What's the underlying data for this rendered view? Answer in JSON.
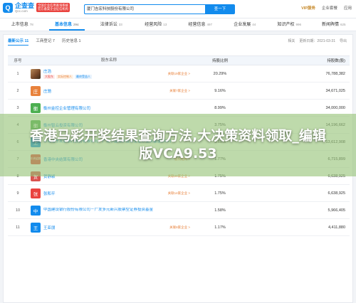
{
  "header": {
    "logo_mark": "Q",
    "logo_name": "企查查",
    "logo_domain": "Qcc.com",
    "slogan_lines": [
      "全国企业信用查询系统",
      "官方备案企业征信机构"
    ],
    "search_value": "厦门吉宏科技股份有限公司",
    "search_button": "查一下",
    "vip": "VIP服务",
    "links": [
      "企业套餐",
      "应用"
    ]
  },
  "tabs": [
    {
      "label": "上市信息",
      "count": "78"
    },
    {
      "label": "基本信息",
      "count": "294"
    },
    {
      "label": "法律诉讼",
      "count": "33"
    },
    {
      "label": "经营风险",
      "count": "13"
    },
    {
      "label": "经营信息",
      "count": "497"
    },
    {
      "label": "企业发展",
      "count": "44"
    },
    {
      "label": "知识产权",
      "count": "996"
    },
    {
      "label": "新闻舆情",
      "count": "625"
    }
  ],
  "subtabs": [
    "最新公示 11",
    "工商登记 7",
    "历史信息 1"
  ],
  "meta": [
    "相关",
    "更新日期：2021-03-31",
    "导出"
  ],
  "columns": {
    "index": "序号",
    "holder": "股东名称",
    "ratio": "持股比例",
    "amount": "持股数(股)"
  },
  "rows": [
    {
      "idx": "1",
      "avatar": "",
      "avatar_color": "#8b5a3c",
      "name": "庄浩",
      "relation": "关联19家企业 >",
      "tags": [
        "大股东",
        "实际控制人",
        "最终受益人"
      ],
      "ratio": "20.29%",
      "amount": "76,788,382"
    },
    {
      "idx": "2",
      "avatar": "庄",
      "avatar_color": "#e8823c",
      "name": "庄驰",
      "relation": "关联7家企业 >",
      "tags": [],
      "ratio": "9.16%",
      "amount": "34,671,025"
    },
    {
      "idx": "3",
      "avatar": "衡",
      "avatar_color": "#4caf50",
      "name": "衡州金控企业管理有限公司",
      "relation": "",
      "tags": [],
      "ratio": "8.99%",
      "amount": "34,000,000"
    },
    {
      "idx": "4",
      "avatar": "衡",
      "avatar_color": "#4caf50",
      "name": "衡州智云投资有限公司",
      "relation": "",
      "tags": [],
      "ratio": "3.75%",
      "amount": "14,196,662"
    },
    {
      "idx": "6",
      "avatar": "上",
      "avatar_color": "#128bed",
      "name": "上海浦东发展银行股份有限公司－广发小盘成长混合型证券投资基金(LOF)",
      "relation": "",
      "tags": [],
      "ratio": "3.60%",
      "amount": "13,612,908"
    },
    {
      "idx": "7",
      "avatar": "中央结算",
      "avatar_color": "#e9433f",
      "name": "香港中央结算有限公司",
      "relation": "股权结构 >",
      "tags": [],
      "ratio": "1.77%",
      "amount": "6,715,899"
    },
    {
      "idx": "8",
      "avatar": "贺",
      "avatar_color": "#d9534f",
      "name": "贺静颖",
      "relation": "关联29家企业 >",
      "tags": [],
      "ratio": "1.75%",
      "amount": "6,638,925"
    },
    {
      "idx": "9",
      "avatar": "张",
      "avatar_color": "#e9433f",
      "name": "张和平",
      "relation": "关联14家企业 >",
      "tags": [],
      "ratio": "1.75%",
      "amount": "6,638,925"
    },
    {
      "idx": "10",
      "avatar": "中",
      "avatar_color": "#128bed",
      "name": "中国建设银行股份有限公司－广发多元新兴股票型证券投资基金",
      "relation": "",
      "tags": [],
      "ratio": "1.58%",
      "amount": "5,966,405"
    },
    {
      "idx": "11",
      "avatar": "王",
      "avatar_color": "#128bed",
      "name": "王亚朋",
      "relation": "关联8家企业 >",
      "tags": [],
      "ratio": "1.17%",
      "amount": "4,411,880"
    }
  ],
  "overlay": {
    "text": "香港马彩开奖结果查询方法,大决策资料领取_编辑版VCA9.53"
  },
  "colors": {
    "accent": "#128bed",
    "relation": "#e8823c",
    "overlay": "#96c378"
  }
}
